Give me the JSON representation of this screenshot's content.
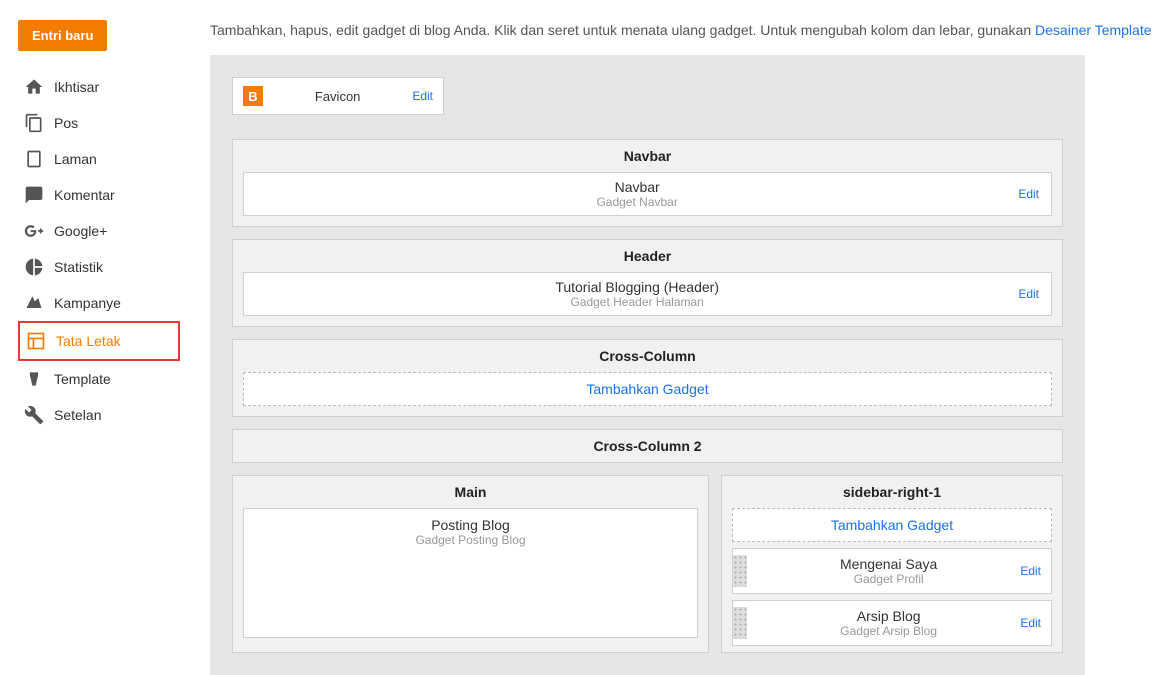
{
  "sidebar": {
    "new_entry": "Entri baru",
    "items": [
      {
        "label": "Ikhtisar",
        "icon": "home"
      },
      {
        "label": "Pos",
        "icon": "posts"
      },
      {
        "label": "Laman",
        "icon": "pages"
      },
      {
        "label": "Komentar",
        "icon": "comments"
      },
      {
        "label": "Google+",
        "icon": "gplus"
      },
      {
        "label": "Statistik",
        "icon": "stats"
      },
      {
        "label": "Kampanye",
        "icon": "campaign"
      },
      {
        "label": "Tata Letak",
        "icon": "layout"
      },
      {
        "label": "Template",
        "icon": "template"
      },
      {
        "label": "Setelan",
        "icon": "settings"
      }
    ]
  },
  "intro": {
    "text": "Tambahkan, hapus, edit gadget di blog Anda. Klik dan seret untuk menata ulang gadget. Untuk mengubah kolom dan lebar, gunakan ",
    "link": "Desainer Template"
  },
  "favicon": {
    "title": "Favicon",
    "edit": "Edit",
    "glyph": "B"
  },
  "sections": {
    "navbar": {
      "header": "Navbar",
      "title": "Navbar",
      "subtitle": "Gadget Navbar",
      "edit": "Edit"
    },
    "header": {
      "header": "Header",
      "title": "Tutorial Blogging (Header)",
      "subtitle": "Gadget Header Halaman",
      "edit": "Edit"
    },
    "cross": {
      "header": "Cross-Column",
      "add": "Tambahkan Gadget"
    },
    "cross2": {
      "header": "Cross-Column 2"
    },
    "main": {
      "header": "Main",
      "title": "Posting Blog",
      "subtitle": "Gadget Posting Blog"
    },
    "right": {
      "header": "sidebar-right-1",
      "add": "Tambahkan Gadget",
      "widgets": [
        {
          "title": "Mengenai Saya",
          "subtitle": "Gadget Profil",
          "edit": "Edit"
        },
        {
          "title": "Arsip Blog",
          "subtitle": "Gadget Arsip Blog",
          "edit": "Edit"
        }
      ]
    }
  }
}
